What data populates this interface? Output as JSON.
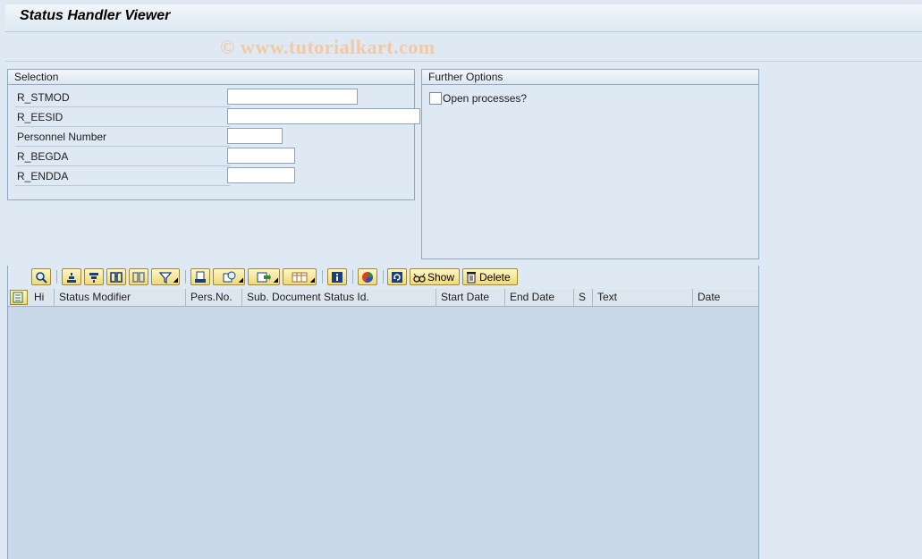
{
  "title": "Status Handler Viewer",
  "watermark": "© www.tutorialkart.com",
  "selection": {
    "header": "Selection",
    "fields": [
      {
        "label": "R_STMOD",
        "value": ""
      },
      {
        "label": "R_EESID",
        "value": ""
      },
      {
        "label": "Personnel Number",
        "value": ""
      },
      {
        "label": "R_BEGDA",
        "value": ""
      },
      {
        "label": "R_ENDDA",
        "value": ""
      }
    ]
  },
  "further_options": {
    "header": "Further Options",
    "open_processes_label": "Open processes?",
    "open_processes_checked": false
  },
  "alv": {
    "toolbar": {
      "show_label": "Show",
      "delete_label": "Delete",
      "icons": [
        "details-icon",
        "sort-ascending-icon",
        "sort-descending-icon",
        "find-icon",
        "find-next-icon",
        "filter-icon",
        "print-icon",
        "views-icon",
        "export-icon",
        "layout-icon",
        "info-icon",
        "graphic-icon",
        "refresh-icon",
        "show-icon",
        "delete-icon"
      ]
    },
    "columns": [
      "Hi",
      "Status Modifier",
      "Pers.No.",
      "Sub. Document Status Id.",
      "Start Date",
      "End Date",
      "S",
      "Text",
      "Date"
    ],
    "rows": []
  }
}
